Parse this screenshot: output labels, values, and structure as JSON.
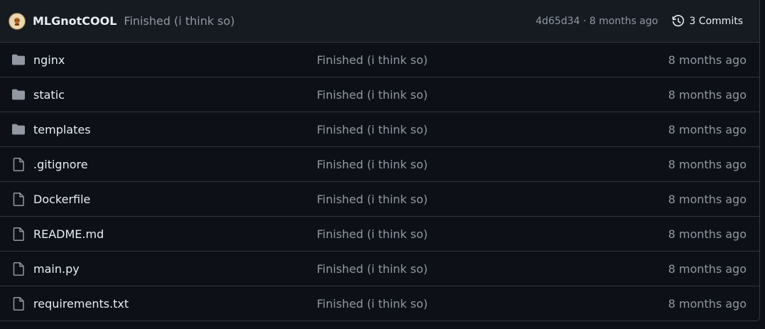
{
  "header": {
    "author": "MLGnotCOOL",
    "message": "Finished (i think so)",
    "meta": "4d65d34 · 8 months ago",
    "commits_label": "3 Commits",
    "icons": {
      "avatar": "avatar-icon",
      "history": "history-icon"
    }
  },
  "colors": {
    "background": "#0d1117",
    "header_background": "#161b22",
    "border": "#30363d",
    "text": "#e6edf3",
    "muted": "#9198a1",
    "folder_icon": "#9198a1"
  },
  "files": [
    {
      "name": "nginx",
      "type": "folder",
      "message": "Finished (i think so)",
      "age": "8 months ago"
    },
    {
      "name": "static",
      "type": "folder",
      "message": "Finished (i think so)",
      "age": "8 months ago"
    },
    {
      "name": "templates",
      "type": "folder",
      "message": "Finished (i think so)",
      "age": "8 months ago"
    },
    {
      "name": ".gitignore",
      "type": "file",
      "message": "Finished (i think so)",
      "age": "8 months ago"
    },
    {
      "name": "Dockerfile",
      "type": "file",
      "message": "Finished (i think so)",
      "age": "8 months ago"
    },
    {
      "name": "README.md",
      "type": "file",
      "message": "Finished (i think so)",
      "age": "8 months ago"
    },
    {
      "name": "main.py",
      "type": "file",
      "message": "Finished (i think so)",
      "age": "8 months ago"
    },
    {
      "name": "requirements.txt",
      "type": "file",
      "message": "Finished (i think so)",
      "age": "8 months ago"
    }
  ]
}
